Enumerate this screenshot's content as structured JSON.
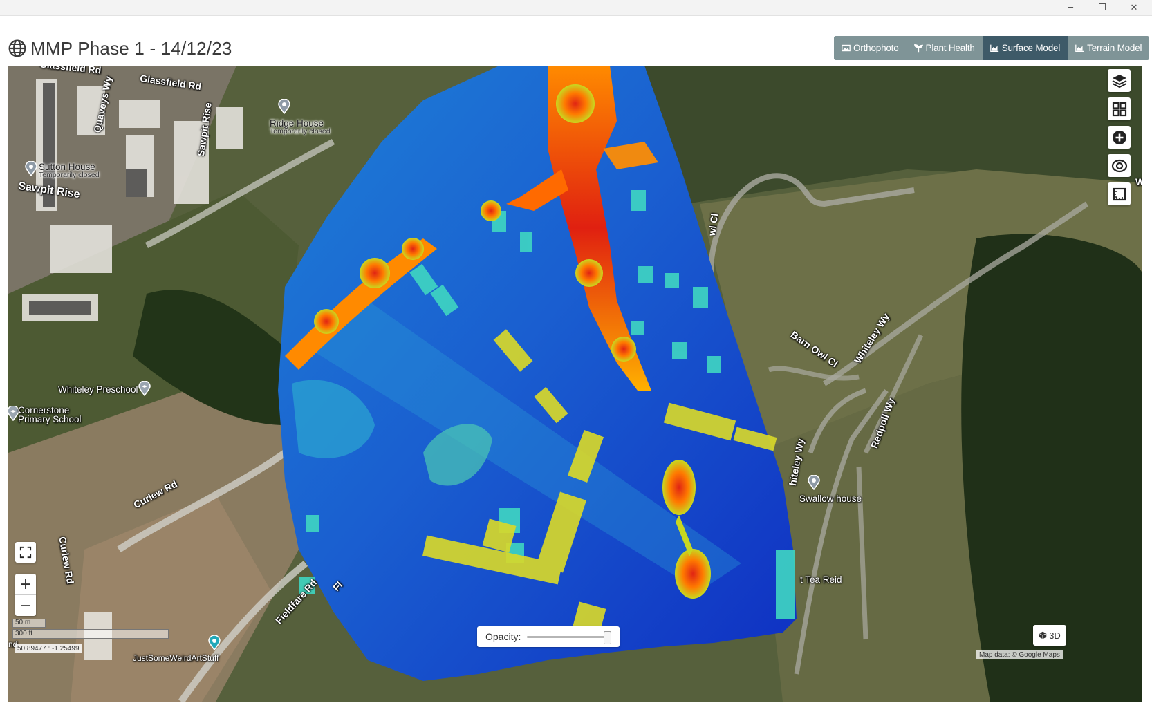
{
  "window": {
    "minimize_glyph": "─",
    "restore_glyph": "❐",
    "close_glyph": "✕"
  },
  "header": {
    "title": "MMP Phase 1 - 14/12/23",
    "icon": "globe-icon"
  },
  "layer_tabs": [
    {
      "label": "Orthophoto",
      "icon": "image-icon",
      "active": false
    },
    {
      "label": "Plant Health",
      "icon": "plant-icon",
      "active": false
    },
    {
      "label": "Surface Model",
      "icon": "area-chart-icon",
      "active": true
    },
    {
      "label": "Terrain Model",
      "icon": "area-chart-icon",
      "active": false
    }
  ],
  "map": {
    "roads": {
      "glassfield_1": "Glassfield Rd",
      "glassfield_2": "Glassfield Rd",
      "quaveys": "Quaveys Wy",
      "sawpit_rise_v": "Sawpit Rise",
      "sawpit_rise": "Sawpit Rise",
      "curlew_rd": "Curlew Rd",
      "curlew_rd_v": "Curlew Rd",
      "fieldfare": "Fieldfare Rd",
      "barn_owl": "Barn Owl Cl",
      "whiteley_wy": "Whiteley Wy",
      "redpoll": "Redpoll Wy",
      "whiteley_wy2": "hiteley Wy",
      "owl_cl": "wl Cl",
      "fl": "Fl",
      "w_edge": "W"
    },
    "places": {
      "ridge_house": "Ridge House",
      "ridge_house_sub": "Temporarily closed",
      "sutton_house": "Sutton House",
      "sutton_house_sub": "Temporarily closed",
      "preschool": "Whiteley Preschool",
      "school_1": "Cornerstone",
      "school_2": "Primary School",
      "swallow": "Swallow house",
      "tea_reid": "t Tea Reid",
      "nd": "nd",
      "jus": "JustSomeWeirdArtStuff"
    },
    "scale": {
      "metric": "50 m",
      "imperial": "300 ft"
    },
    "coords": "50.89477 : -1.25499",
    "attribution": "Map data: © Google Maps",
    "opacity_label": "Opacity:",
    "opacity_value": 0.95,
    "btn_3d": "3D",
    "tools": [
      "layers-icon",
      "grid-icon",
      "plus-circle-icon",
      "eye-icon",
      "measure-icon"
    ]
  }
}
